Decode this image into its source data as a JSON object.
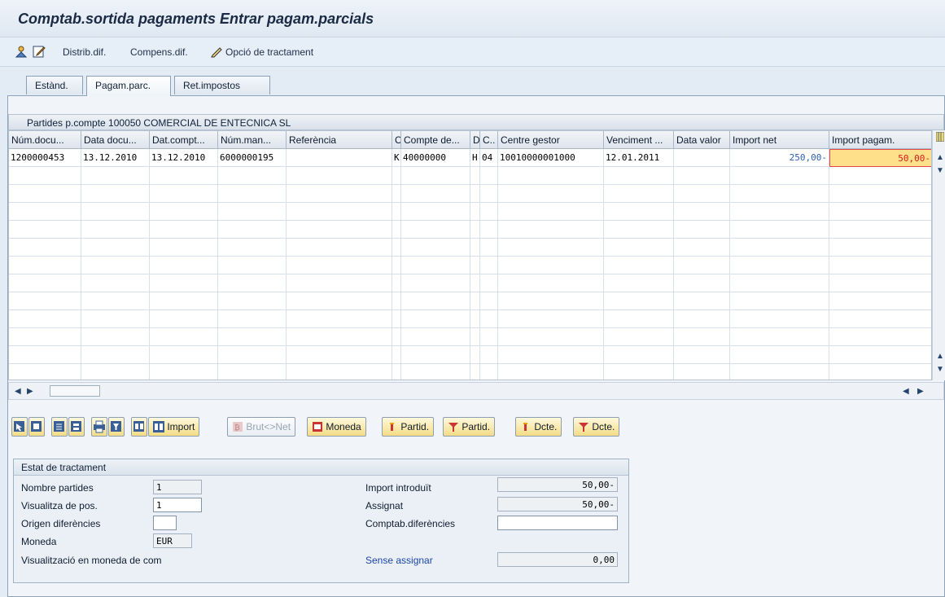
{
  "title": "Comptab.sortida pagaments Entrar pagam.parcials",
  "toolbar": {
    "distrib": "Distrib.dif.",
    "compens": "Compens.dif.",
    "opcio": "Opció de tractament"
  },
  "tabs": [
    {
      "label": "Estànd."
    },
    {
      "label": "Pagam.parc."
    },
    {
      "label": "Ret.impostos"
    }
  ],
  "grid": {
    "title": "Partides p.compte 100050 COMERCIAL DE ENTECNICA SL",
    "headers": [
      "Núm.docu...",
      "Data docu...",
      "Dat.compt...",
      "Núm.man...",
      "Referència",
      "C",
      "Compte de...",
      "D",
      "C..",
      "Centre gestor",
      "Venciment ...",
      "Data valor",
      "Import net",
      "Import pagam."
    ],
    "row1": [
      "1200000453",
      "13.12.2010",
      "13.12.2010",
      "6000000195",
      "",
      "K",
      "40000000",
      "H",
      "04",
      "10010000001000",
      "12.01.2011",
      "",
      "250,00-",
      "50,00-"
    ]
  },
  "buttons": {
    "import": "Import",
    "brut_net": "Brut<>Net",
    "moneda": "Moneda",
    "partid1": "Partid.",
    "partid2": "Partid.",
    "dcte1": "Dcte.",
    "dcte2": "Dcte."
  },
  "status": {
    "title": "Estat de tractament",
    "nombre_partides_label": "Nombre partides",
    "nombre_partides_value": "1",
    "visualitza_label": "Visualitza de pos.",
    "visualitza_value": "1",
    "origen_label": "Origen diferències",
    "origen_value": "",
    "moneda_label": "Moneda",
    "moneda_value": "EUR",
    "visualitzacio_label": "Visualització en moneda de com",
    "import_introduit_label": "Import introduït",
    "import_introduit_value": "50,00-",
    "assignat_label": "Assignat",
    "assignat_value": "50,00-",
    "comptab_label": "Comptab.diferències",
    "comptab_value": "",
    "sense_label": "Sense assignar",
    "sense_value": "0,00"
  },
  "colors": {
    "accent_yellow": "#ffe08a",
    "net_blue": "#2b5fb3",
    "pay_red": "#d81b1b"
  }
}
